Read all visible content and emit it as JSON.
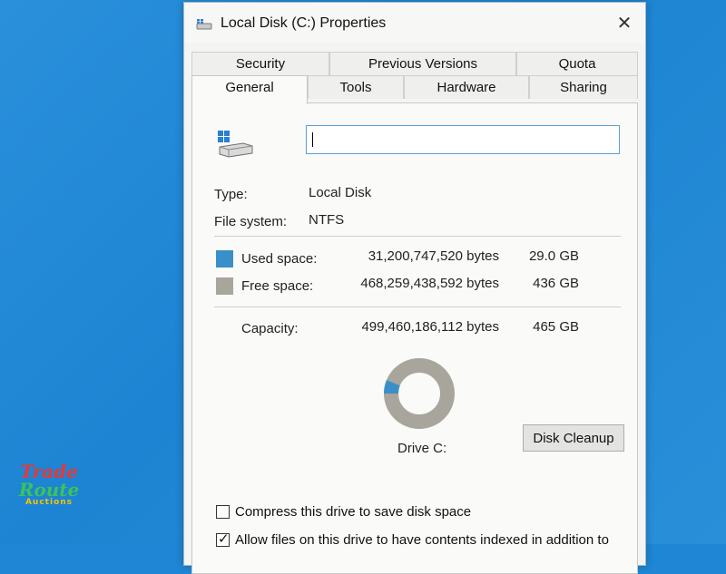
{
  "window": {
    "title": "Local Disk (C:) Properties",
    "close_symbol": "✕"
  },
  "tabs": {
    "row1": [
      "Security",
      "Previous Versions",
      "Quota"
    ],
    "row2": [
      "General",
      "Tools",
      "Hardware",
      "Sharing"
    ],
    "active": "General"
  },
  "general": {
    "name_value": "",
    "type_label": "Type:",
    "type_value": "Local Disk",
    "fs_label": "File system:",
    "fs_value": "NTFS",
    "used_label": "Used space:",
    "used_bytes": "31,200,747,520 bytes",
    "used_gb": "29.0 GB",
    "free_label": "Free space:",
    "free_bytes": "468,259,438,592 bytes",
    "free_gb": "436 GB",
    "capacity_label": "Capacity:",
    "capacity_bytes": "499,460,186,112 bytes",
    "capacity_gb": "465 GB",
    "drive_label": "Drive C:",
    "cleanup_label": "Disk Cleanup",
    "used_fraction": 0.0625,
    "compress_label": "Compress this drive to save disk space",
    "compress_checked": false,
    "index_label": "Allow files on this drive to have contents indexed in addition to",
    "index_checked": true
  },
  "colors": {
    "used": "#3a8fc9",
    "free": "#a8a59c",
    "accent": "#5b9fd8"
  },
  "icons": {
    "title": "drive-icon",
    "close": "close-icon",
    "drive": "windows-drive-icon"
  },
  "watermark": {
    "line1": "Trade",
    "line2": "Route",
    "line3": "Auctions"
  }
}
